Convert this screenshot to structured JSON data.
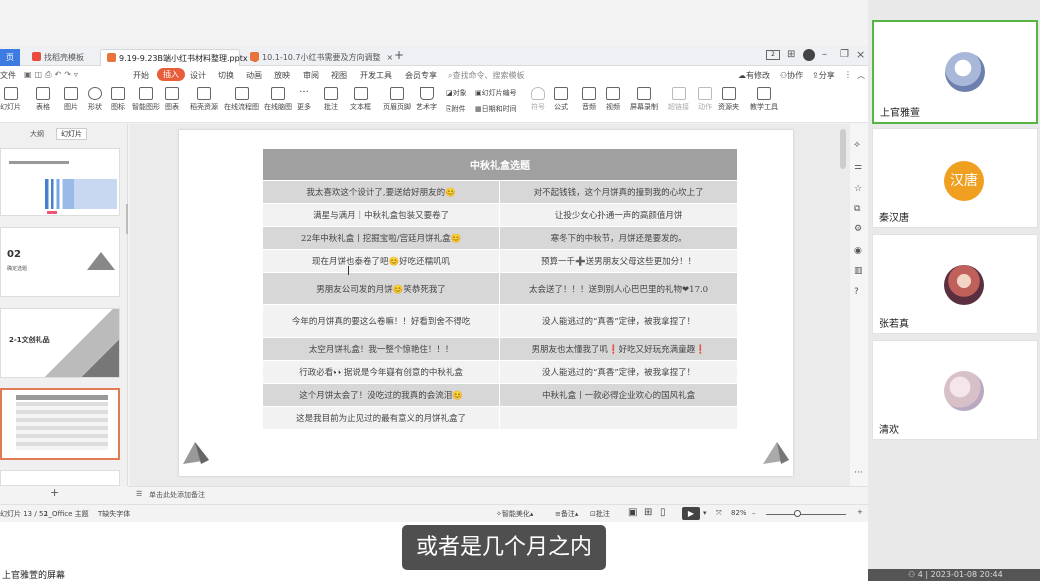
{
  "tabs": [
    {
      "label": "页",
      "active": false
    },
    {
      "label": "找稻壳模板",
      "active": false
    },
    {
      "label": "9.19-9.23B端小红书材料整理.pptx",
      "active": true
    },
    {
      "label": "10.1-10.7小红书需要及方向调整",
      "active": false
    }
  ],
  "menu": [
    "文件",
    "开始",
    "插入",
    "设计",
    "切换",
    "动画",
    "放映",
    "审阅",
    "视图",
    "开发工具",
    "会员专享",
    "查找命令、搜索模板",
    "有修改",
    "协作",
    "分享"
  ],
  "menu_selected": "插入",
  "ribbon": [
    "幻灯片",
    "表格",
    "图片",
    "形状",
    "图标",
    "智能图形",
    "图表",
    "稻壳资源",
    "在线流程图",
    "在线脑图",
    "更多",
    "批注",
    "文本框",
    "页眉页脚",
    "艺术字",
    "对象",
    "幻灯片编号",
    "附件",
    "日期和时间",
    "符号",
    "公式",
    "音频",
    "视频",
    "屏幕录制",
    "超链接",
    "动作",
    "资源夹",
    "教学工具"
  ],
  "panel_tabs": [
    "大纲",
    "幻灯片"
  ],
  "thumbs": {
    "slide2_num": "02",
    "slide2_sub": "确定选题",
    "slide3_title": "2-1文创礼品"
  },
  "table": {
    "title": "中秋礼盒选题",
    "rows": [
      [
        "我太喜欢这个设计了,要送给好朋友的😊",
        "对不起钱钱，这个月饼真的撞到我的心坎上了"
      ],
      [
        "满星与满月｜中秋礼盒包装又要卷了",
        "让投少女心扑通一声的高颜值月饼"
      ],
      [
        "22年中秋礼盒丨挖掘宝啦/宫廷月饼礼盒😊",
        "寒冬下的中秋节，月饼还是要发的。"
      ],
      [
        "现在月饼也泰卷了吧😊好吃还糯叽叽",
        "预算一千➕送男朋友父母这些更加分！！"
      ],
      [
        "男朋友公司发的月饼😊笑恭死我了",
        "太会送了！！！送到别人心巴巴里的礼物❤17.0"
      ],
      [
        "今年的月饼真的要这么卷嘛！！好看到舍不得吃",
        "没人能逃过的“真香”定律，被我拿捏了！"
      ],
      [
        "太空月饼礼盒！我一整个惊艳住！！！",
        "男朋友也太懂我了叽❗好吃又好玩充满童趣❗"
      ],
      [
        "行政必看👀据说是今年嶷有创意的中秋礼盒",
        "没人能逃过的“真香”定律，被我拿捏了！"
      ],
      [
        "这个月饼太会了！没吃过的我真的会流泪😊",
        "中秋礼盒丨一款必得企业欢心的国风礼盒"
      ],
      [
        "这是我目前为止见过的最有意义的月饼礼盒了",
        ""
      ]
    ]
  },
  "notes_placeholder": "单击此处添加备注",
  "status": {
    "slide_info": "幻灯片 13 / 52",
    "theme": "1_Office 主题",
    "font_missing": "缺失字体",
    "beautify": "智能美化",
    "notes": "备注",
    "comment": "批注",
    "zoom": "82%"
  },
  "subtitle": "或者是几个月之内",
  "screen_share_label": "上官雅萱的屏幕",
  "participants": [
    {
      "name": "上官雅萱",
      "avatar_text": "",
      "color": "#7a8fb8",
      "active": true
    },
    {
      "name": "秦汉唐",
      "avatar_text": "汉唐",
      "color": "#f0a020",
      "active": false
    },
    {
      "name": "张若真",
      "avatar_text": "",
      "color": "#c0605a",
      "active": false
    },
    {
      "name": "清欢",
      "avatar_text": "",
      "color": "#c8b8c8",
      "active": false
    }
  ],
  "meeting_bar": {
    "count": "4",
    "datetime": "2023-01-08 20:44"
  }
}
